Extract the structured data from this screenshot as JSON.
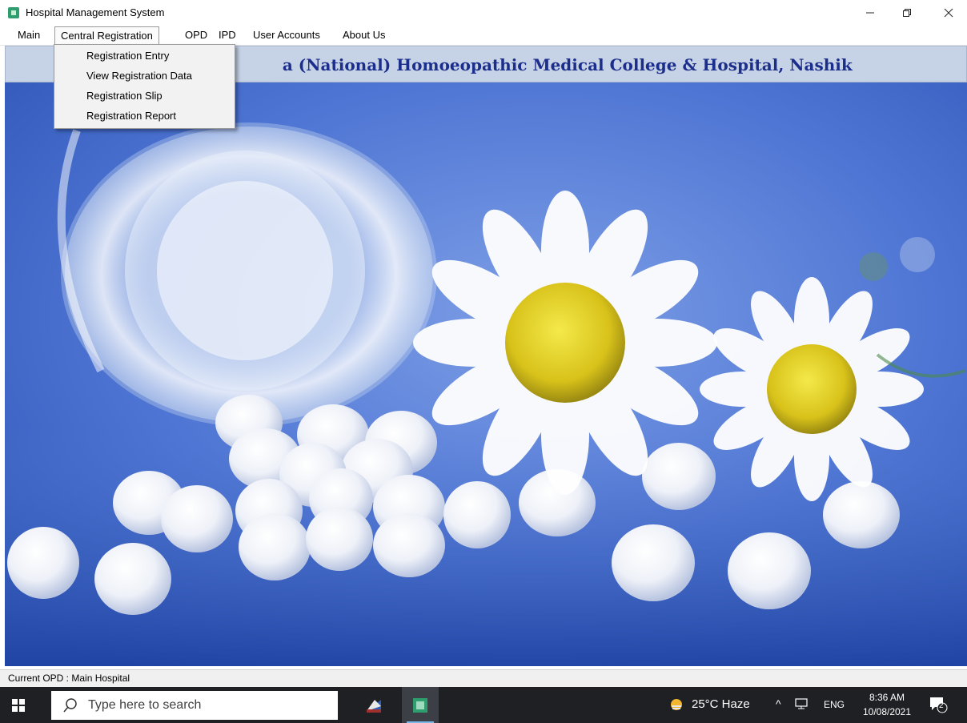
{
  "window": {
    "title": "Hospital Management System",
    "min_icon": "minimize-icon",
    "max_icon": "restore-icon",
    "close_icon": "close-icon"
  },
  "menu": {
    "items": [
      "Main",
      "Central Registration",
      "OPD",
      "IPD",
      "User Accounts",
      "About Us"
    ],
    "active": "Central Registration"
  },
  "dropdown": {
    "items": [
      "Registration Entry",
      "View Registration Data",
      "Registration Slip",
      "Registration Report"
    ]
  },
  "header": {
    "visible_text": "a (National) Homoeopathic Medical College & Hospital, Nashik",
    "color": "#1c2e8c",
    "background": "#c6d2e6"
  },
  "hero": {
    "subject": "homeopathic pills, glass jar and chamomile flowers",
    "background_color": "#4d74d3"
  },
  "status": {
    "label": "Current OPD :",
    "value": "Main Hospital"
  },
  "taskbar": {
    "search_placeholder": "Type here to search",
    "weather": "25°C  Haze",
    "language": "ENG",
    "time": "8:36 AM",
    "date": "10/08/2021",
    "notification_count": "2",
    "background": "#1f2024"
  }
}
